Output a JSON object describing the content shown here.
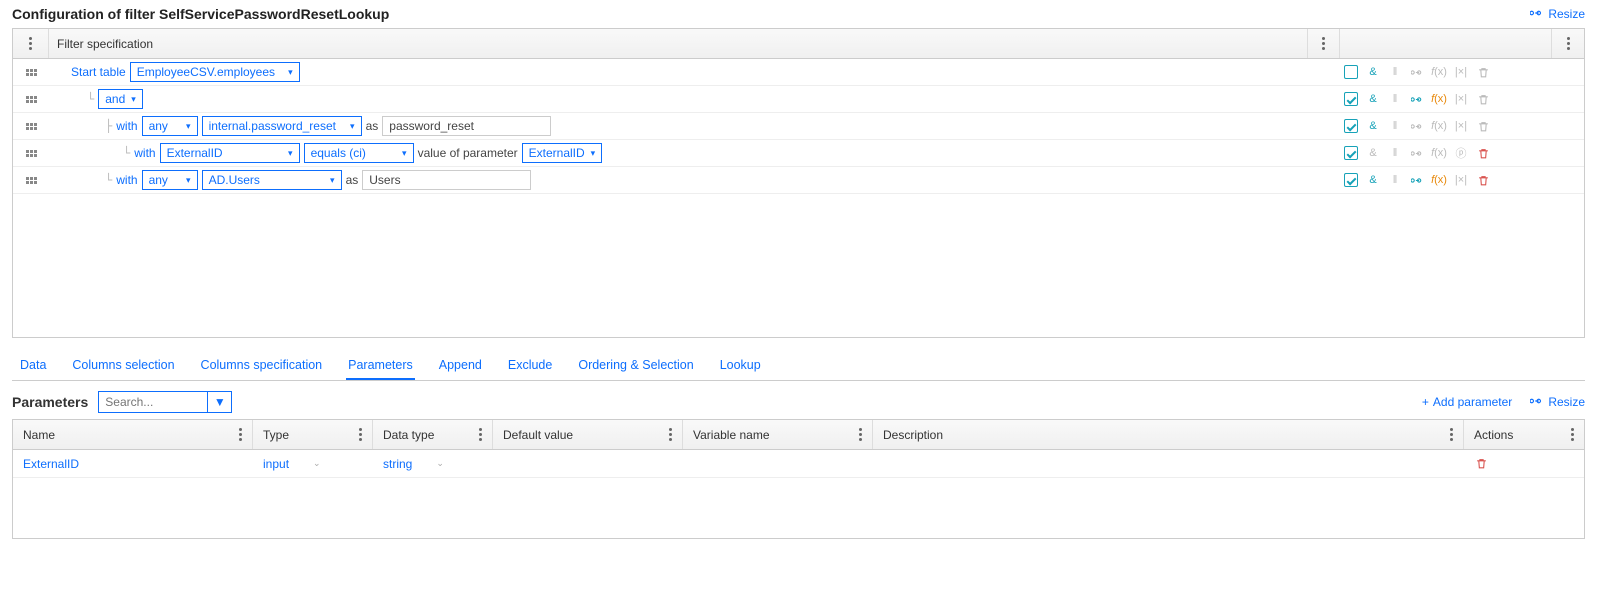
{
  "title": "Configuration of filter SelfServicePasswordResetLookup",
  "resize_label": "Resize",
  "filter_header": "Filter specification",
  "rows": {
    "r1_label": "Start table",
    "r1_select": "EmployeeCSV.employees",
    "r2_select": "and",
    "r3_with": "with",
    "r3_sel1": "any",
    "r3_sel2": "internal.password_reset",
    "r3_as": "as",
    "r3_alias": "password_reset",
    "r4_with": "with",
    "r4_sel1": "ExternalID",
    "r4_sel2": "equals (ci)",
    "r4_mid": "value of parameter",
    "r4_sel3": "ExternalID",
    "r5_with": "with",
    "r5_sel1": "any",
    "r5_sel2": "AD.Users",
    "r5_as": "as",
    "r5_alias": "Users"
  },
  "tabs": [
    "Data",
    "Columns selection",
    "Columns specification",
    "Parameters",
    "Append",
    "Exclude",
    "Ordering & Selection",
    "Lookup"
  ],
  "active_tab_index": 3,
  "params_title": "Parameters",
  "search_placeholder": "Search...",
  "add_param_label": "Add parameter",
  "phead": {
    "name": "Name",
    "type": "Type",
    "dt": "Data type",
    "def": "Default value",
    "var": "Variable name",
    "desc": "Description",
    "act": "Actions"
  },
  "prow": {
    "name": "ExternalID",
    "type": "input",
    "dt": "string"
  }
}
